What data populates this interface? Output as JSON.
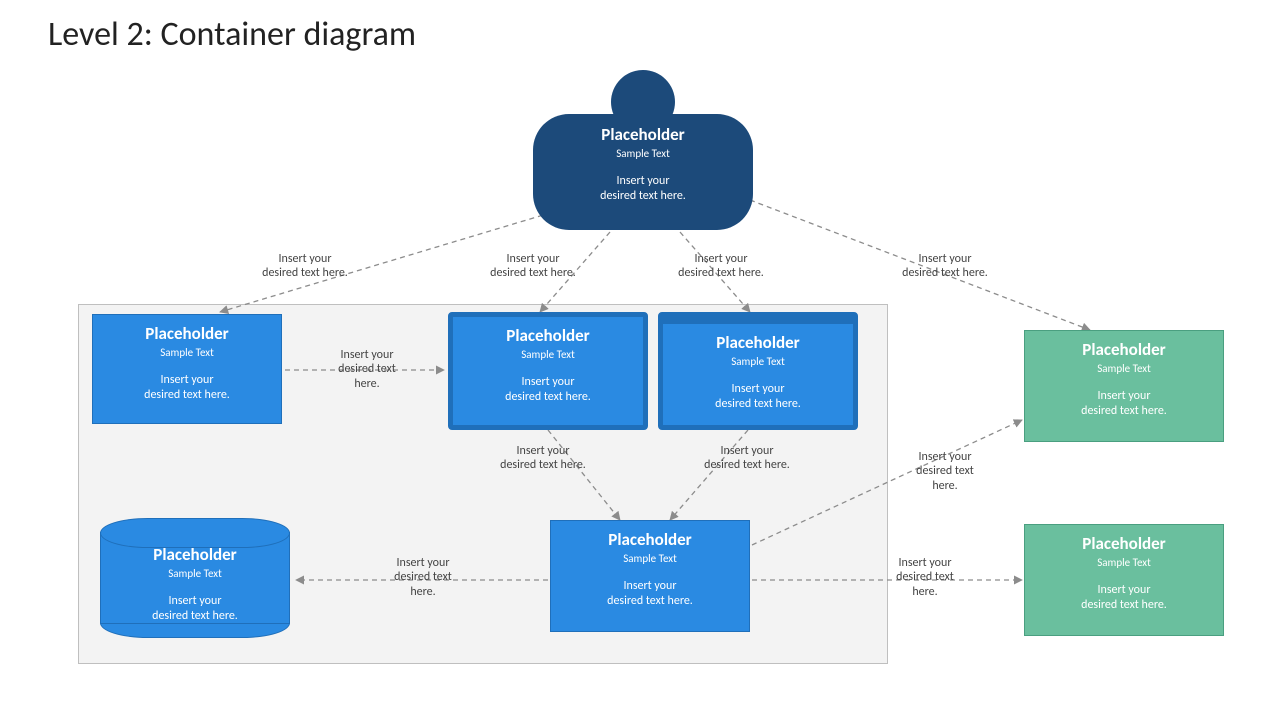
{
  "title": "Level 2: Container diagram",
  "common": {
    "ph_title": "Placeholder",
    "ph_sub": "Sample Text",
    "ph_body_l1": "Insert your",
    "ph_body_l2": "desired text here."
  },
  "edge_label_l1": "Insert your",
  "edge_label_l2": "desired text here.",
  "edge_label_l2_short": "desired text",
  "edge_label_l3_short": "here.",
  "nodes": {
    "actor": {
      "kind": "person"
    },
    "web_app": {
      "kind": "container"
    },
    "spa": {
      "kind": "container-tablet"
    },
    "mobile_app": {
      "kind": "container-browser"
    },
    "api": {
      "kind": "container"
    },
    "database": {
      "kind": "database"
    },
    "ext1": {
      "kind": "external"
    },
    "ext2": {
      "kind": "external"
    }
  }
}
